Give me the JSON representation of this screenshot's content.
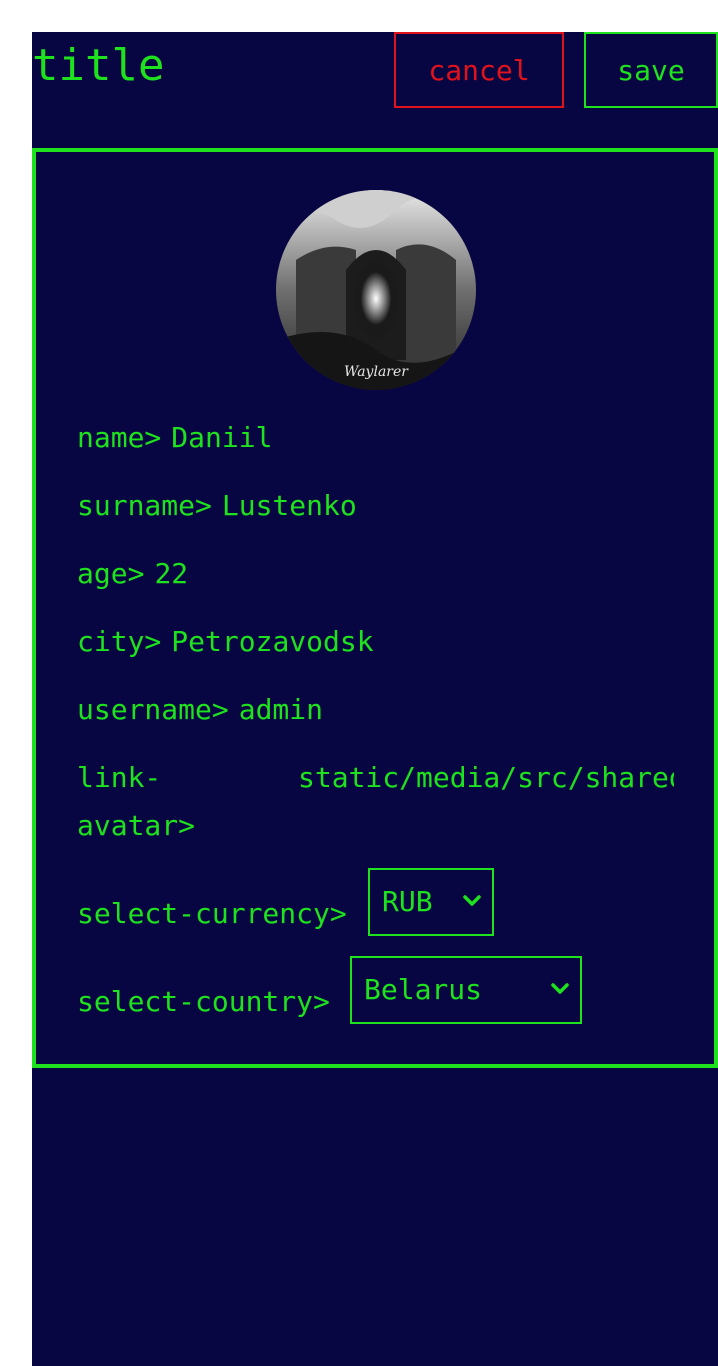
{
  "header": {
    "title": "title",
    "cancel_label": "cancel",
    "save_label": "save"
  },
  "profile": {
    "fields": {
      "name": {
        "label": "name>",
        "value": "Daniil"
      },
      "surname": {
        "label": "surname>",
        "value": "Lustenko"
      },
      "age": {
        "label": "age>",
        "value": "22"
      },
      "city": {
        "label": "city>",
        "value": "Petrozavodsk"
      },
      "username": {
        "label": "username>",
        "value": "admin"
      },
      "link_avatar": {
        "label": "link-avatar>",
        "value": "static/media/src/shared"
      }
    },
    "avatar": {
      "caption": "Waylarer",
      "icon": "avatar-image"
    },
    "selects": {
      "currency": {
        "label": "select-currency>",
        "value": "RUB"
      },
      "country": {
        "label": "select-country>",
        "value": "Belarus"
      }
    }
  },
  "colors": {
    "background": "#080642",
    "accent": "#1ee21e",
    "danger": "#e0121c"
  }
}
